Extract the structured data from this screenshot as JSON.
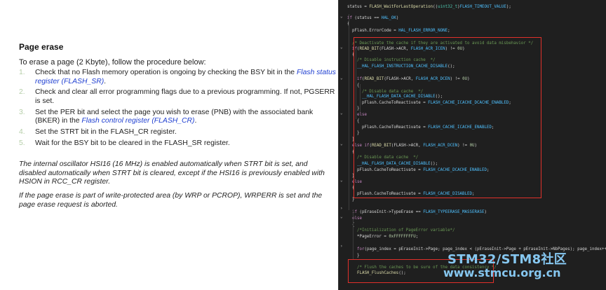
{
  "doc": {
    "title": "Page erase",
    "intro": "To erase a page (2 Kbyte), follow the procedure below:",
    "steps": [
      {
        "num": "1.",
        "pre": "Check that no Flash memory operation is ongoing by checking the BSY bit in the ",
        "link": "Flash status register (FLASH_SR)",
        "post": "."
      },
      {
        "num": "2.",
        "pre": "Check and clear all error programming flags due to a previous programming. If not, PGSERR is set.",
        "link": "",
        "post": ""
      },
      {
        "num": "3.",
        "pre": "Set the PER bit and select the page you wish to erase (PNB) with the associated bank (BKER) in the ",
        "link": "Flash control register (FLASH_CR)",
        "post": "."
      },
      {
        "num": "4.",
        "pre": "Set the STRT bit in the FLASH_CR register.",
        "link": "",
        "post": ""
      },
      {
        "num": "5.",
        "pre": "Wait for the BSY bit to be cleared in the FLASH_SR register.",
        "link": "",
        "post": ""
      }
    ],
    "note1": "The internal oscillator HSI16 (16 MHz) is enabled automatically when STRT bit is set, and disabled automatically when STRT bit is cleared, except if the HSI16 is previously enabled with HSION in RCC_CR register.",
    "note2": "If the page erase is part of write-protected area (by WRP or PCROP), WRPERR is set and the page erase request is aborted."
  },
  "code": {
    "lines": [
      "status = FLASH_WaitForLastOperation((uint32_t)FLASH_TIMEOUT_VALUE);",
      "",
      "if (status == HAL_OK)",
      "{",
      "  pFlash.ErrorCode = HAL_FLASH_ERROR_NONE;",
      "",
      "  /* Deactivate the cache if they are activated to avoid data misbehavior */",
      "  if(READ_BIT(FLASH->ACR, FLASH_ACR_ICEN) != 0U)",
      "  {",
      "    /* Disable instruction cache  */",
      "    __HAL_FLASH_INSTRUCTION_CACHE_DISABLE();",
      "",
      "    if(READ_BIT(FLASH->ACR, FLASH_ACR_DCEN) != 0U)",
      "    {",
      "      /* Disable data cache  */",
      "      __HAL_FLASH_DATA_CACHE_DISABLE();",
      "      pFlash.CacheToReactivate = FLASH_CACHE_ICACHE_DCACHE_ENABLED;",
      "    }",
      "    else",
      "    {",
      "      pFlash.CacheToReactivate = FLASH_CACHE_ICACHE_ENABLED;",
      "    }",
      "  }",
      "  else if(READ_BIT(FLASH->ACR, FLASH_ACR_DCEN) != 0U)",
      "  {",
      "    /* Disable data cache  */",
      "    __HAL_FLASH_DATA_CACHE_DISABLE();",
      "    pFlash.CacheToReactivate = FLASH_CACHE_DCACHE_ENABLED;",
      "  }",
      "  else",
      "  {",
      "    pFlash.CacheToReactivate = FLASH_CACHE_DISABLED;",
      "  }",
      "",
      "",
      "  if (pEraseInit->TypeErase == FLASH_TYPEERASE_MASSERASE)",
      "  else",
      "  {",
      "    /*Initialization of PageError variable*/",
      "    *PageError = 0xFFFFFFFFU;",
      "",
      "",
      "    for(page_index = pEraseInit->Page; page_index < (pEraseInit->Page + pEraseInit->NbPages); page_index++)",
      "    }",
      "",
      "    /* Flush the caches to be sure of the data consistency */",
      "    FLASH_FlushCaches();",
      ""
    ]
  },
  "watermark": {
    "line1": "STM32/STM8社区",
    "line2": "www.stmcu.org.cn"
  },
  "colors": {
    "editor_bg": "#1f1f1f",
    "highlight_box": "#e0302a",
    "link": "#1f3fd1",
    "watermark": "#86c7f0"
  }
}
